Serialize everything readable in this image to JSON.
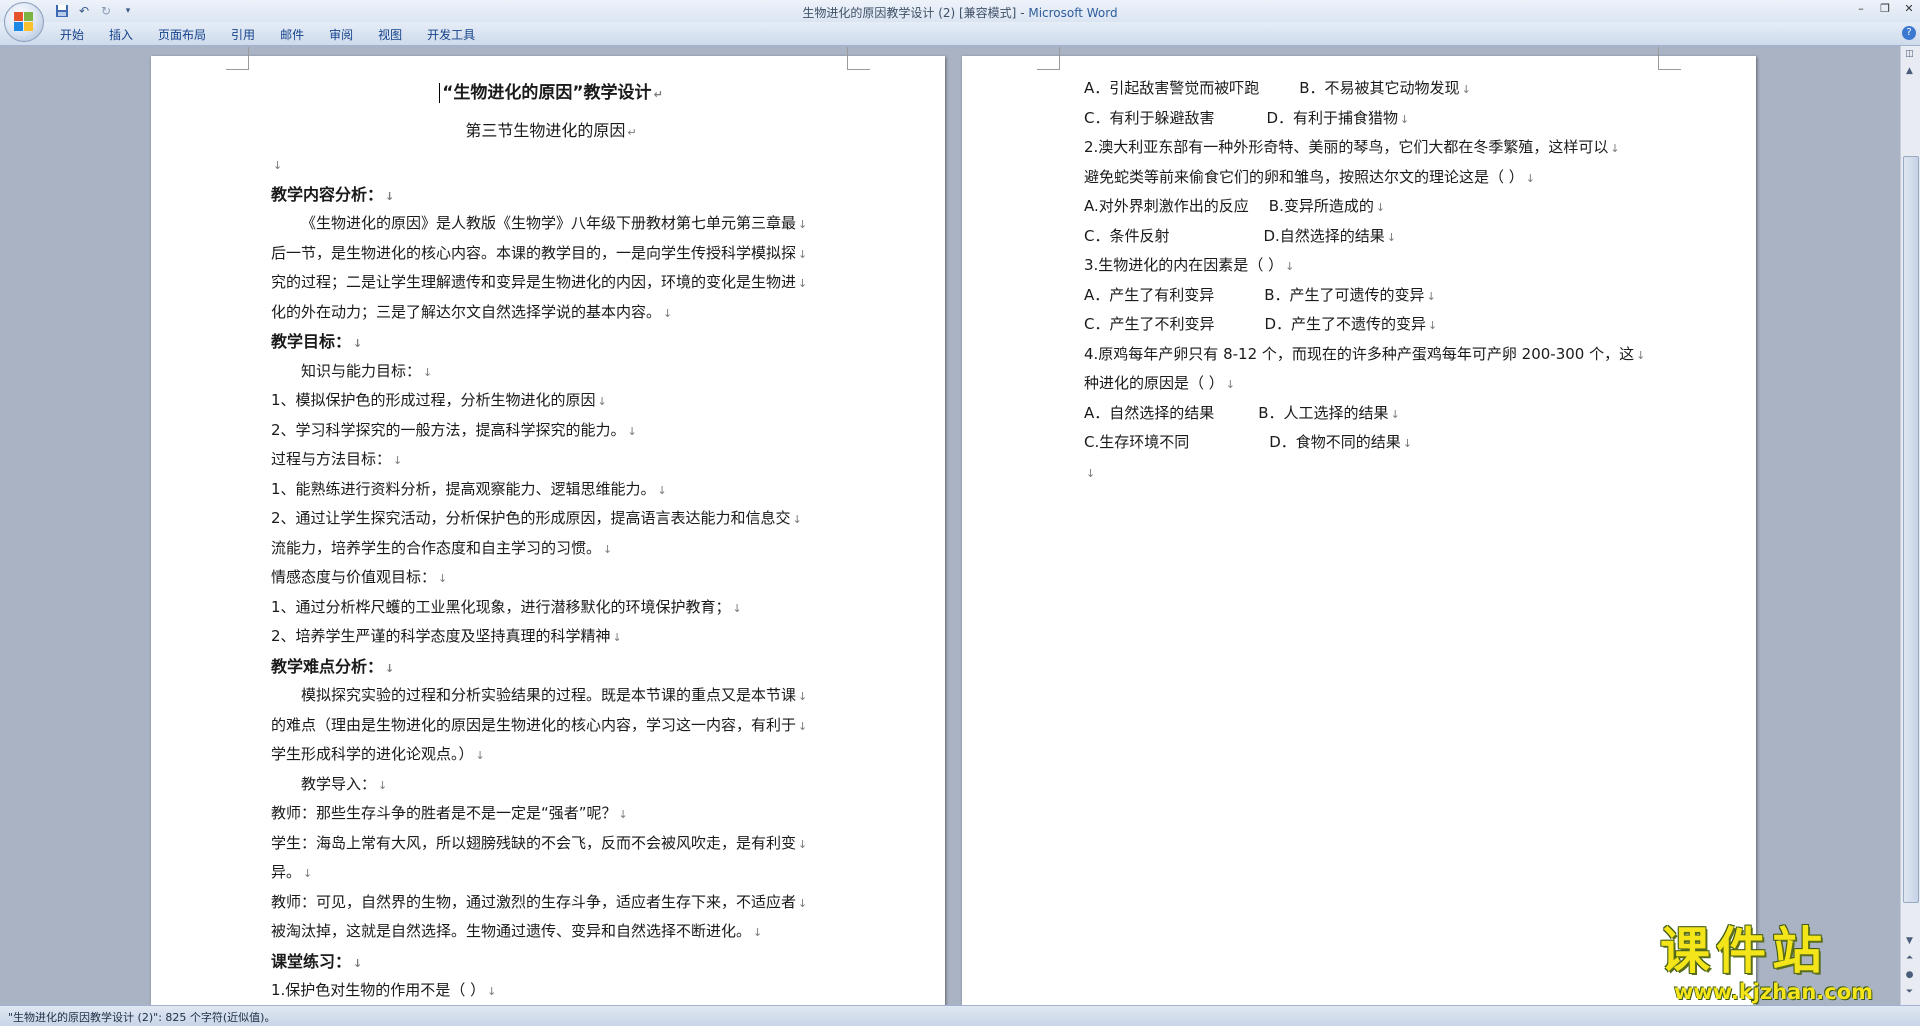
{
  "window": {
    "title": "生物进化的原因教学设计 (2) [兼容模式]",
    "app_name": "Microsoft Word",
    "title_separator": " - "
  },
  "quick_access": [
    "save-icon",
    "undo-icon",
    "redo-icon",
    "customize-icon"
  ],
  "ribbon": {
    "tabs": [
      "开始",
      "插入",
      "页面布局",
      "引用",
      "邮件",
      "审阅",
      "视图",
      "开发工具"
    ]
  },
  "page1": {
    "title": "“生物进化的原因”教学设计",
    "subtitle": "第三节生物进化的原因",
    "lines": [
      {
        "text": "",
        "style": "blank"
      },
      {
        "text": "教学内容分析：",
        "style": "heading"
      },
      {
        "text": "《生物进化的原因》是人教版《生物学》八年级下册教材第七单元第三章最",
        "style": "indent"
      },
      {
        "text": "后一节，是生物进化的核心内容。本课的教学目的，一是向学生传授科学模拟探",
        "style": "normal"
      },
      {
        "text": "究的过程；二是让学生理解遗传和变异是生物进化的内因，环境的变化是生物进",
        "style": "normal"
      },
      {
        "text": "化的外在动力；三是了解达尔文自然选择学说的基本内容。",
        "style": "normal"
      },
      {
        "text": "教学目标：",
        "style": "heading"
      },
      {
        "text": "知识与能力目标：",
        "style": "indent"
      },
      {
        "text": "1、模拟保护色的形成过程，分析生物进化的原因",
        "style": "normal"
      },
      {
        "text": "2、学习科学探究的一般方法，提高科学探究的能力。",
        "style": "normal"
      },
      {
        "text": "过程与方法目标：",
        "style": "normal"
      },
      {
        "text": "1、能熟练进行资料分析，提高观察能力、逻辑思维能力。",
        "style": "normal"
      },
      {
        "text": "2、通过让学生探究活动，分析保护色的形成原因，提高语言表达能力和信息交",
        "style": "normal"
      },
      {
        "text": "流能力，培养学生的合作态度和自主学习的习惯。",
        "style": "normal"
      },
      {
        "text": "情感态度与价值观目标：",
        "style": "normal"
      },
      {
        "text": "1、通过分析桦尺蠖的工业黑化现象，进行潜移默化的环境保护教育；",
        "style": "normal"
      },
      {
        "text": "2、培养学生严谨的科学态度及坚持真理的科学精神",
        "style": "normal"
      },
      {
        "text": "教学难点分析：",
        "style": "heading"
      },
      {
        "text": "模拟探究实验的过程和分析实验结果的过程。既是本节课的重点又是本节课",
        "style": "indent"
      },
      {
        "text": "的难点（理由是生物进化的原因是生物进化的核心内容，学习这一内容，有利于",
        "style": "normal"
      },
      {
        "text": "学生形成科学的进化论观点。）",
        "style": "normal"
      },
      {
        "text": "教学导入：",
        "style": "indent"
      },
      {
        "text": "教师：那些生存斗争的胜者是不是一定是“强者”呢？",
        "style": "normal"
      },
      {
        "text": "学生：海岛上常有大风，所以翅膀残缺的不会飞，反而不会被风吹走，是有利变",
        "style": "normal"
      },
      {
        "text": "异。",
        "style": "normal"
      },
      {
        "text": "教师：可见，自然界的生物，通过激烈的生存斗争，适应者生存下来，不适应者",
        "style": "normal"
      },
      {
        "text": "被淘汰掉，这就是自然选择。生物通过遗传、变异和自然选择不断进化。",
        "style": "normal"
      },
      {
        "text": "课堂练习：",
        "style": "heading"
      },
      {
        "text": "1.保护色对生物的作用不是（      ）",
        "style": "normal"
      }
    ]
  },
  "page2": {
    "lines": [
      {
        "a": "A．引起敌害警觉而被吓跑",
        "b": "B．不易被其它动物发现",
        "gap": 40
      },
      {
        "a": "C．有利于躲避敌害",
        "b": "D．有利于捕食猎物",
        "gap": 52
      },
      {
        "text": "2.澳大利亚东部有一种外形奇特、美丽的琴鸟，它们大都在冬季繁殖，这样可以"
      },
      {
        "text": "避免蛇类等前来偷食它们的卵和雏鸟，按照达尔文的理论这是（      ）"
      },
      {
        "a": "A.对外界刺激作出的反应",
        "b": "B.变异所造成的",
        "gap": 20
      },
      {
        "a": "C．条件反射",
        "b": "D.自然选择的结果",
        "gap": 94
      },
      {
        "text": "3.生物进化的内在因素是（      ）"
      },
      {
        "a": "A．产生了有利变异",
        "b": "B．产生了可遗传的变异",
        "gap": 50
      },
      {
        "a": "C．产生了不利变异",
        "b": "D．产生了不遗传的变异",
        "gap": 50
      },
      {
        "text": "4.原鸡每年产卵只有 8-12 个，而现在的许多种产蛋鸡每年可产卵 200-300 个，这"
      },
      {
        "text": "种进化的原因是（   ）"
      },
      {
        "a": "A．自然选择的结果",
        "b": "B．人工选择的结果",
        "gap": 44
      },
      {
        "a": "C.生存环境不同",
        "b": "D．食物不同的结果",
        "gap": 80
      },
      {
        "text": ""
      }
    ]
  },
  "marks": {
    "para": "↵",
    "line": "↓"
  },
  "statusbar": {
    "text": "\"生物进化的原因教学设计 (2)\": 825 个字符(近似值)。"
  },
  "watermark": {
    "main": "课件站",
    "url": "www.kjzhan.com"
  },
  "colors": {
    "workspace": "#a9b3c3",
    "ribbon_text": "#15428b",
    "watermark_fill": "#f4e51a"
  }
}
